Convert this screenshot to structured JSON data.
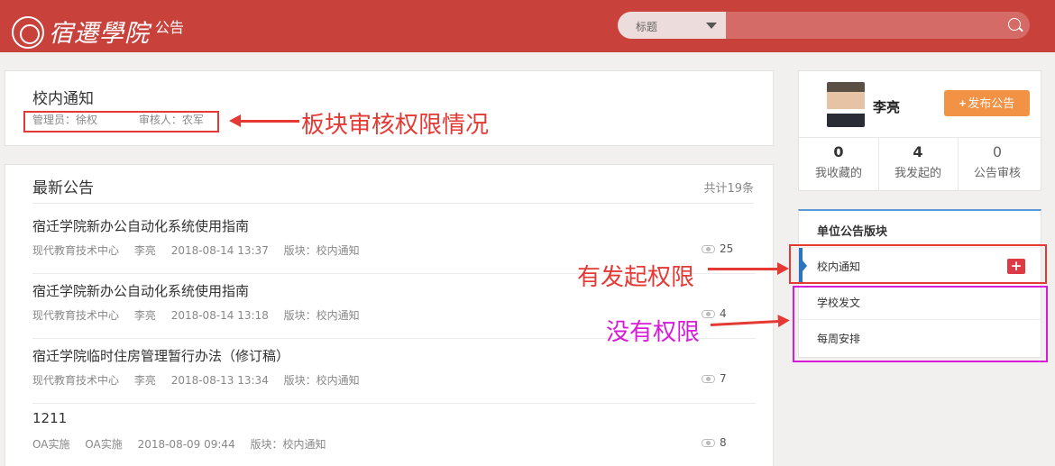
{
  "header": {
    "logo_text": "宿遷學院",
    "module_title": "公告",
    "search": {
      "field": "标题",
      "placeholder": ""
    }
  },
  "board": {
    "title": "校内通知",
    "admin": "管理员：徐权",
    "reviewer": "审核人：农军"
  },
  "list": {
    "title": "最新公告",
    "total": "共计19条",
    "items": [
      {
        "title": "宿迁学院新办公自动化系统使用指南",
        "dept": "现代教育技术中心",
        "author": "李亮",
        "time": "2018-08-14 13:37",
        "board": "版块：校内通知",
        "views": "25"
      },
      {
        "title": "宿迁学院新办公自动化系统使用指南",
        "dept": "现代教育技术中心",
        "author": "李亮",
        "time": "2018-08-14 13:18",
        "board": "版块：校内通知",
        "views": "4"
      },
      {
        "title": "宿迁学院临时住房管理暂行办法（修订稿）",
        "dept": "现代教育技术中心",
        "author": "李亮",
        "time": "2018-08-13 13:34",
        "board": "版块：校内通知",
        "views": "7"
      },
      {
        "title": "1211",
        "dept": "OA实施",
        "author": "OA实施",
        "time": "2018-08-09 09:44",
        "board": "版块：校内通知",
        "views": "8"
      }
    ]
  },
  "profile": {
    "name": "李亮",
    "publish_label": "发布公告",
    "stats": [
      {
        "num": "0",
        "label": "我收藏的"
      },
      {
        "num": "4",
        "label": "我发起的"
      },
      {
        "num": "0",
        "label": "公告审核"
      }
    ]
  },
  "categories": {
    "header": "单位公告版块",
    "items": [
      "校内通知",
      "学校发文",
      "每周安排"
    ],
    "add_label": "+"
  },
  "annotations": {
    "board_perm": "板块审核权限情况",
    "can_publish": "有发起权限",
    "no_perm": "没有权限"
  },
  "colors": {
    "header_bg": "#c8413b",
    "publish_button": "#f29244",
    "annotation_red": "#e53935",
    "annotation_magenta": "#d81bd9"
  }
}
